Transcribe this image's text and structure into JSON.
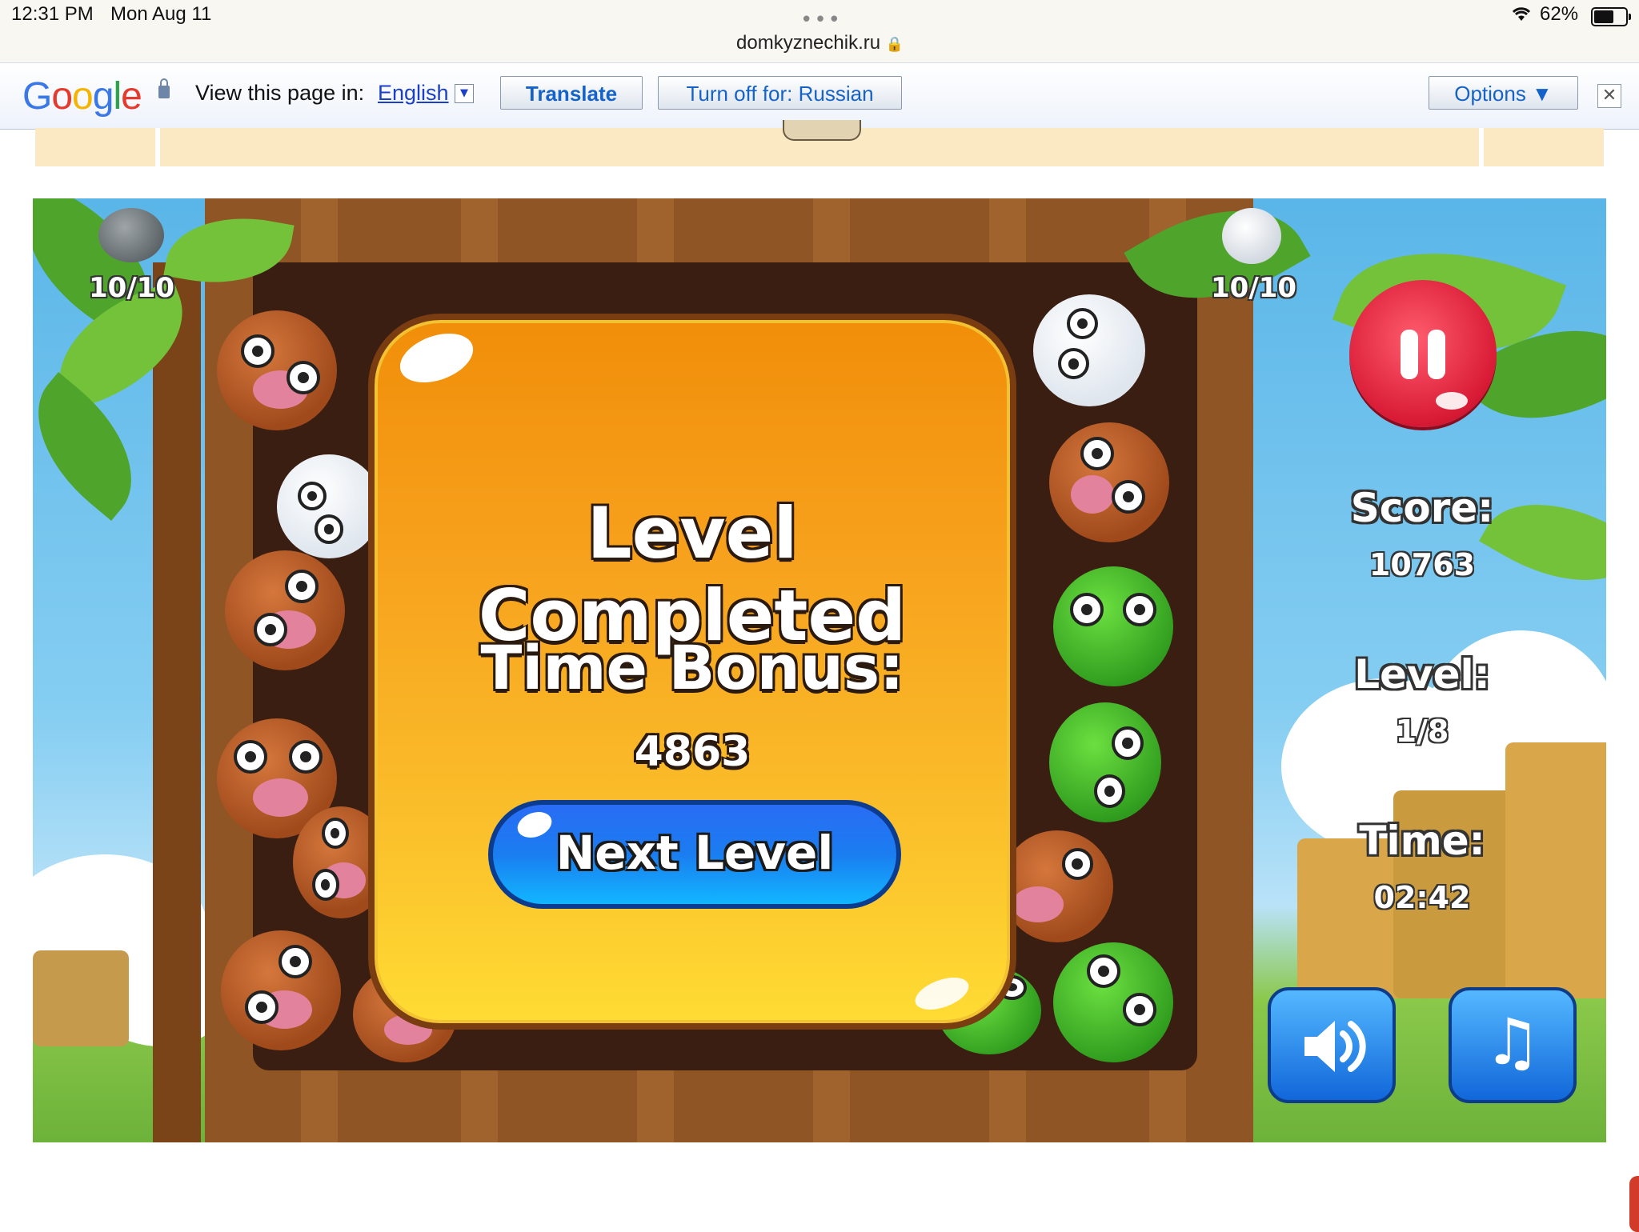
{
  "status_bar": {
    "time": "12:31 PM",
    "date": "Mon Aug 11",
    "url": "domkyznechik.ru",
    "battery": "62%"
  },
  "translate_bar": {
    "logo": "Google",
    "view_in_label": "View this page in:",
    "language": "English",
    "translate_button": "Translate",
    "turn_off_button": "Turn off for: Russian",
    "options_button": "Options ▼"
  },
  "game": {
    "left_counter": "10/10",
    "right_counter": "10/10",
    "score_label": "Score:",
    "score_value": "10763",
    "level_label": "Level:",
    "level_value": "1/8",
    "time_label": "Time:",
    "time_value": "02:42",
    "dialog": {
      "title": "Level Completed",
      "bonus_label": "Time Bonus:",
      "bonus_value": "4863",
      "next_button": "Next Level"
    }
  },
  "icons": {
    "pause": "pause-icon",
    "sound": "speaker-icon",
    "music": "music-note-icon",
    "close": "close-icon",
    "lock": "lock-icon",
    "wifi": "wifi-icon",
    "battery": "battery-icon"
  }
}
